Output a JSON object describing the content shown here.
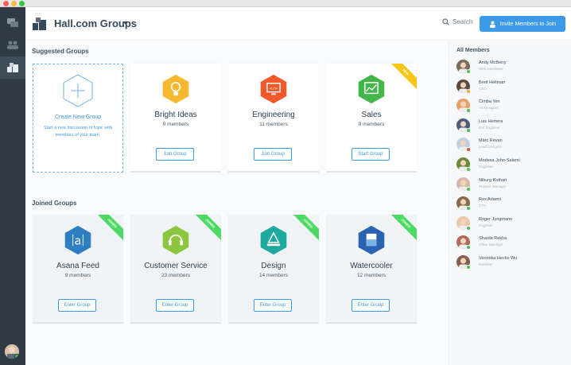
{
  "header": {
    "title": "Hall.com Groups",
    "search_label": "Search",
    "invite_label": "Invite Members to Join"
  },
  "suggested": {
    "section_title": "Suggested Groups",
    "create": {
      "title": "Create New Group",
      "description": "Start a new discussion or topic with members of your team."
    },
    "groups": [
      {
        "name": "Bright Ideas",
        "count": "9 members",
        "button": "Join Group",
        "color": "#f5b82e",
        "icon": "lightbulb-icon"
      },
      {
        "name": "Engineering",
        "count": "11 members",
        "button": "Join Group",
        "color": "#f0592a",
        "icon": "code-monitor-icon"
      },
      {
        "name": "Sales",
        "count": "9 members",
        "button": "Start Group",
        "color": "#43b649",
        "icon": "chart-icon",
        "ribbon": "NEW"
      }
    ]
  },
  "joined": {
    "section_title": "Joined Groups",
    "groups": [
      {
        "name": "Asana Feed",
        "count": "9 members",
        "button": "Enter Group",
        "color": "#2d7fc1",
        "icon": "asana-icon",
        "ribbon": "JOINED"
      },
      {
        "name": "Customer Service",
        "count": "23 members",
        "button": "Enter Group",
        "color": "#8cc63f",
        "icon": "headset-icon",
        "ribbon": "JOINED"
      },
      {
        "name": "Design",
        "count": "14 members",
        "button": "Enter Group",
        "color": "#1fa8a0",
        "icon": "pen-tool-icon",
        "ribbon": "JOINED"
      },
      {
        "name": "Watercooler",
        "count": "12 members",
        "button": "Enter Group",
        "color": "#2a63b0",
        "icon": "cup-icon",
        "ribbon": "JOINED"
      }
    ]
  },
  "members": {
    "title": "All Members",
    "list": [
      {
        "name": "Andy McBerry",
        "role": "Web Developer",
        "status": "#4cc24c",
        "avatar_color": "#7a6b5c"
      },
      {
        "name": "Brett Hellman",
        "role": "CEO",
        "status": "#f5a623",
        "avatar_color": "#5c4a3c"
      },
      {
        "name": "Cimba Yen",
        "role": "Art Designer",
        "status": "#4cc24c",
        "avatar_color": "#e8a06a"
      },
      {
        "name": "Luis Herrera",
        "role": "iOS Engineer",
        "status": "#4cc24c",
        "avatar_color": "#4a5c7a"
      },
      {
        "name": "Marc Revan",
        "role": "Lead Designer",
        "status": "#e74c3c",
        "avatar_color": "#c0d0e0"
      },
      {
        "name": "Modesa John-Salami",
        "role": "Engineer",
        "status": "#4cc24c",
        "avatar_color": "#6b8a3c"
      },
      {
        "name": "Niburg Kothari",
        "role": "Product Manager",
        "status": "#4cc24c",
        "avatar_color": "#d8b8a8"
      },
      {
        "name": "Rex Adams",
        "role": "CTO",
        "status": "#4cc24c",
        "avatar_color": "#8a6a4a"
      },
      {
        "name": "Roger Jungmann",
        "role": "Engineer",
        "status": "#4cc24c",
        "avatar_color": "#e8c8a8"
      },
      {
        "name": "Sharda Rekha",
        "role": "Office Manager",
        "status": "#4cc24c",
        "avatar_color": "#b06a5a"
      },
      {
        "name": "Veronika Hecko Wu",
        "role": "Marketer",
        "status": "#4cc24c",
        "avatar_color": "#8a5a4a"
      }
    ]
  }
}
